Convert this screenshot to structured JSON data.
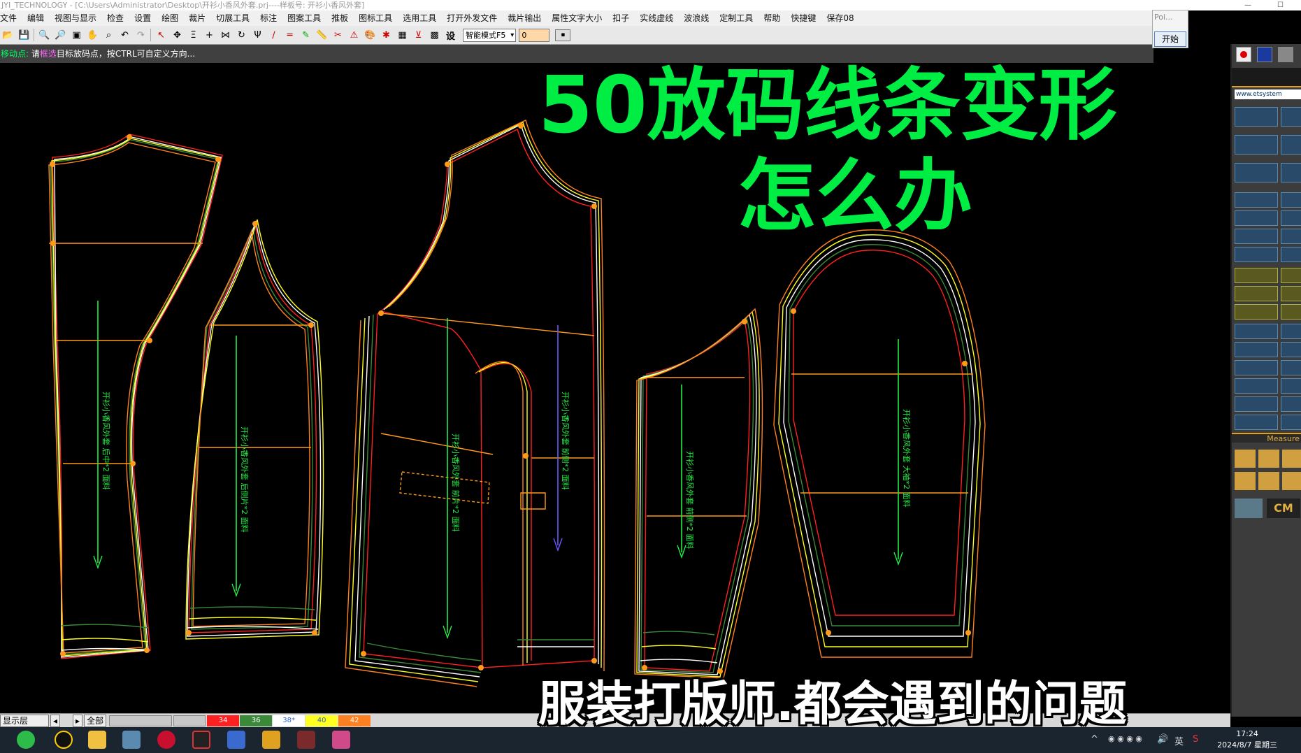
{
  "window": {
    "title": "JYI_TECHNOLOGY - [C:\\Users\\Administrator\\Desktop\\开衫小香风外套.prj----样板号: 开衫小香风外套]"
  },
  "menu": [
    "文件",
    "编辑",
    "视图与显示",
    "检查",
    "设置",
    "绘图",
    "裁片",
    "切展工具",
    "标注",
    "图案工具",
    "推板",
    "图标工具",
    "选用工具",
    "打开外发文件",
    "裁片输出",
    "属性文字大小",
    "扣子",
    "实线虚线",
    "波浪线",
    "定制工具",
    "帮助",
    "快捷键",
    "保存08"
  ],
  "toolbar": {
    "mode_select": "智能模式F5",
    "value_input": "0",
    "icons": [
      "open-icon",
      "save-icon",
      "zoom-out-icon",
      "zoom-in-icon",
      "fit-icon",
      "pan-hand-icon",
      "zoom-window-icon",
      "undo-icon",
      "redo-icon",
      "select-arrow-icon",
      "move-points-icon",
      "align-icon",
      "add-icon",
      "rotate-icon",
      "mirror-icon",
      "cut-icon",
      "line-icon",
      "parallel-icon",
      "pencil-icon",
      "ruler-icon",
      "mark-icon",
      "color-icon",
      "snap-icon",
      "grade-icon",
      "flip-icon",
      "settings-icon"
    ],
    "settings_label": "设"
  },
  "status": {
    "label": "移动点:",
    "prefix": "请",
    "highlight": "框选",
    "text": "目标放码点，按CTRL可自定义方向..."
  },
  "poi_popup": {
    "title": "Poi...",
    "button": "开始"
  },
  "right_panel": {
    "url": "www.etsystem",
    "measure": "Measure",
    "unit": "CM"
  },
  "pieces": [
    {
      "name": "back-piece",
      "text": "开衫小香风外套 后中*2 面料"
    },
    {
      "name": "side-back-piece",
      "text": "开衫小香风外套 后侧片*2 面料"
    },
    {
      "name": "front-piece",
      "text": "开衫小香风外套 前片*2 面料"
    },
    {
      "name": "front-facing-piece",
      "text": "开衫小香风外套 前侧*2 面料"
    },
    {
      "name": "side-piece",
      "text": "开衫小香风外套 前侧*2 面料"
    },
    {
      "name": "sleeve-piece",
      "text": "开衫小香风外套 大袖*2 面料"
    }
  ],
  "bottom_bar": {
    "layer_label": "显示层",
    "all_label": "全部",
    "size_chips": [
      {
        "label": "34",
        "color": "#ff2020"
      },
      {
        "label": "36",
        "color": "#3a8a3a"
      },
      {
        "label": "38*",
        "color": "#ffffff"
      },
      {
        "label": "40",
        "color": "#ffff20"
      },
      {
        "label": "42",
        "color": "#ff8020"
      }
    ]
  },
  "taskbar": {
    "time": "17:24",
    "date": "2024/8/7 星期三",
    "ime": "英"
  },
  "overlay": {
    "title_line1": "50放码线条变形",
    "title_line2": "怎么办",
    "bottom_caption": "服装打版师.都会遇到的问题"
  },
  "colors": {
    "overlay_green": "#00ee44",
    "size34": "#ff2020",
    "size36": "#3a8a3a",
    "size38": "#ffffff",
    "size40": "#ffff20",
    "size42": "#ff8020",
    "grain": "#22ee44",
    "points": "#ff9a1a"
  }
}
